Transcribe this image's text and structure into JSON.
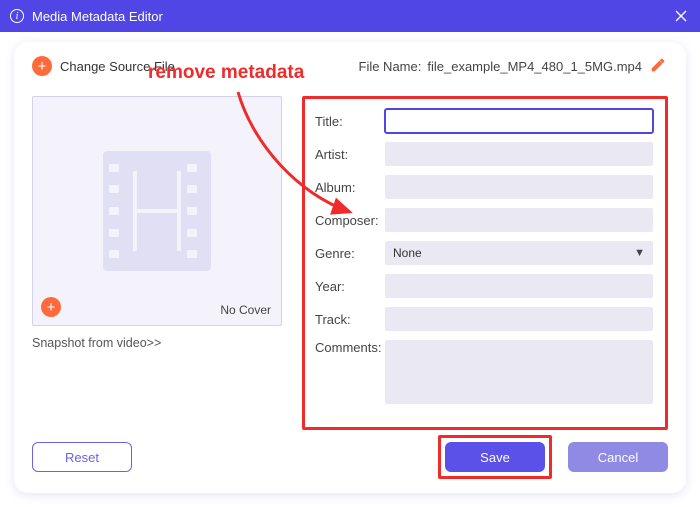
{
  "titlebar": {
    "title": "Media Metadata Editor"
  },
  "top": {
    "change_source": "Change Source File",
    "file_label": "File Name:",
    "file_name": "file_example_MP4_480_1_5MG.mp4"
  },
  "annotation": {
    "text": "remove metadata"
  },
  "cover": {
    "no_cover": "No Cover",
    "snapshot_link": "Snapshot from video>>"
  },
  "form": {
    "title_label": "Title:",
    "artist_label": "Artist:",
    "album_label": "Album:",
    "composer_label": "Composer:",
    "genre_label": "Genre:",
    "genre_value": "None",
    "year_label": "Year:",
    "track_label": "Track:",
    "comments_label": "Comments:"
  },
  "buttons": {
    "reset": "Reset",
    "save": "Save",
    "cancel": "Cancel"
  }
}
